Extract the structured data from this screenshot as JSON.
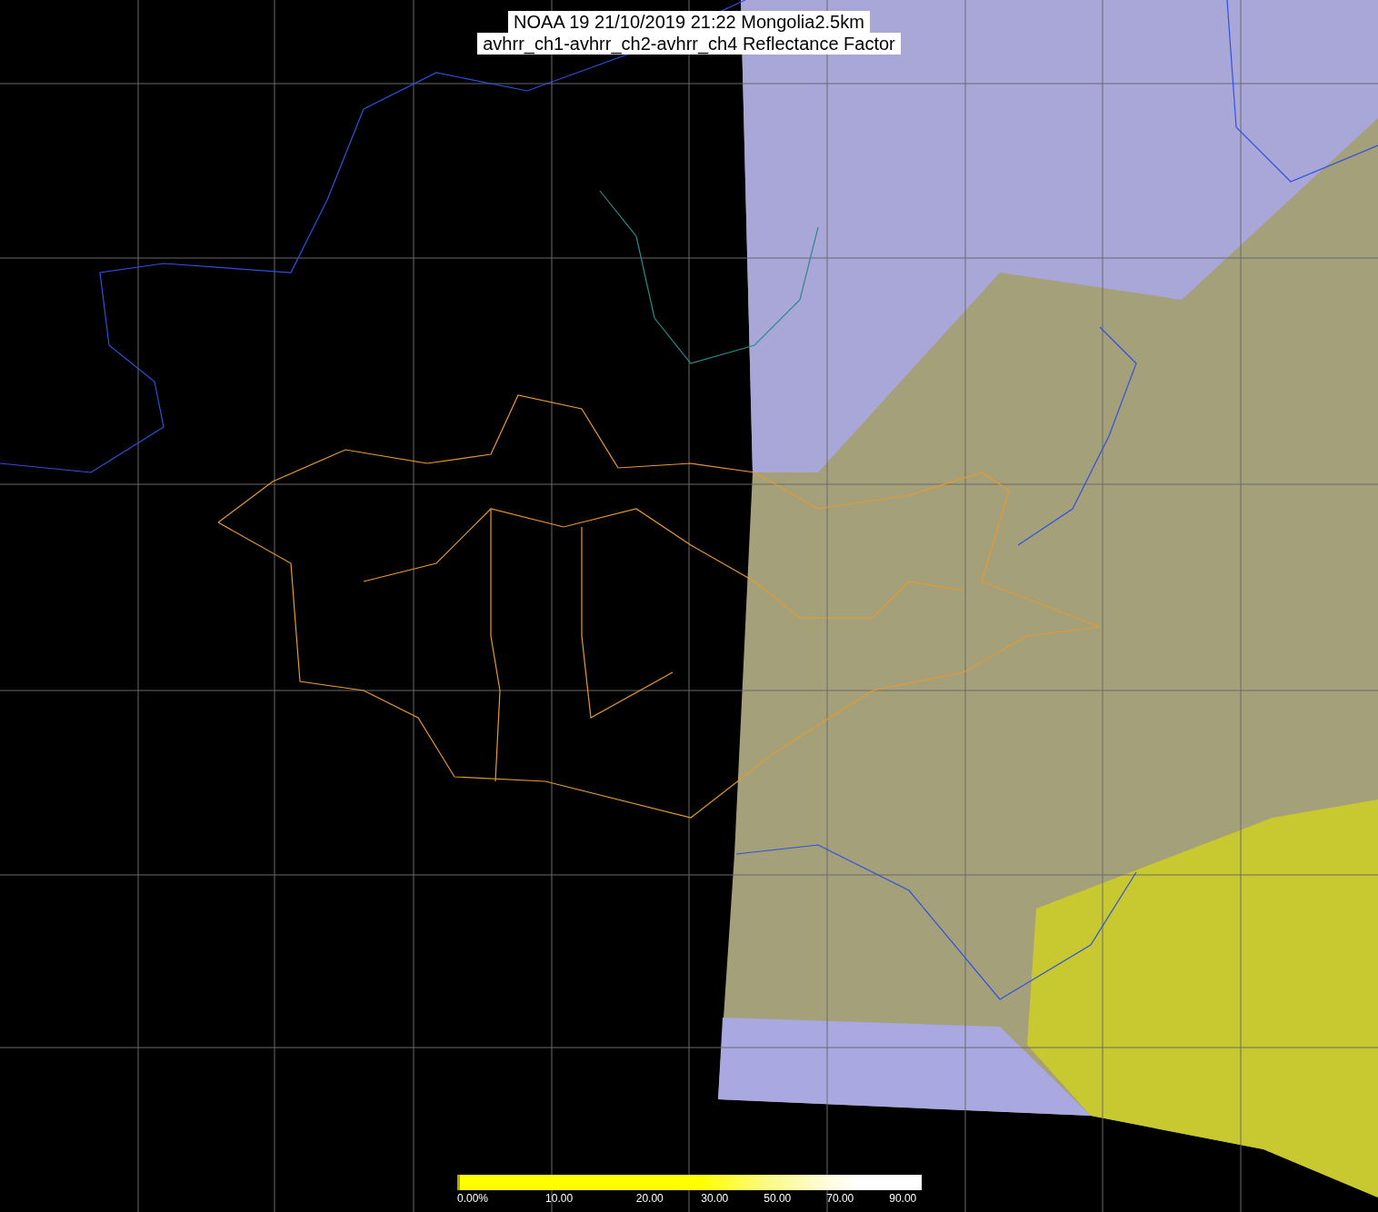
{
  "title": {
    "lines": [
      "NOAA 19 21/10/2019 21:22 Mongolia2.5km",
      "avhrr_ch1-avhrr_ch2-avhrr_ch4 Reflectance Factor"
    ]
  },
  "colorbar": {
    "labels": [
      "0.00%",
      "10.00",
      "20.00",
      "30.00",
      "50.00",
      "70.00",
      "90.00"
    ]
  }
}
